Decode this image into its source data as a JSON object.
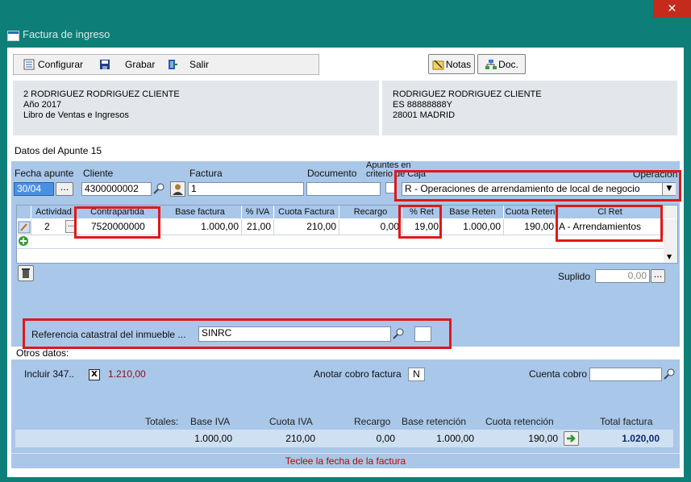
{
  "window": {
    "title": "Factura de ingreso",
    "close": "✕"
  },
  "toolbar": {
    "configurar": "Configurar",
    "grabar": "Grabar",
    "salir": "Salir",
    "notas": "Notas",
    "doc": "Doc."
  },
  "client_box": {
    "line1": "2 RODRIGUEZ RODRIGUEZ CLIENTE",
    "line2": "Año 2017",
    "line3": "Libro de Ventas e Ingresos"
  },
  "customer_box": {
    "line1": "RODRIGUEZ RODRIGUEZ CLIENTE",
    "line2": "ES 88888888Y",
    "line3": "28001 MADRID"
  },
  "apunte": {
    "title": "Datos del Apunte 15"
  },
  "form": {
    "fecha_label": "Fecha apunte",
    "fecha_value": "30/04",
    "cliente_label": "Cliente",
    "cliente_value": "4300000002",
    "factura_label": "Factura",
    "factura_value": "1",
    "documento_label": "Documento",
    "documento_value": "",
    "apuntes_label": "Apuntes en criterio de Caja",
    "operacion_label": "Operación",
    "operacion_value": "R - Operaciones de arrendamiento de local de negocio",
    "dots": "..."
  },
  "grid": {
    "headers": [
      "Actividad",
      "Contrapartida",
      "Base factura",
      "% IVA",
      "Cuota Factura",
      "Recargo",
      "% Ret",
      "Base Reten",
      "Cuota Reten",
      "Cl Ret"
    ],
    "row": [
      "2",
      "7520000000",
      "1.000,00",
      "21,00",
      "210,00",
      "0,00",
      "19,00",
      "1.000,00",
      "190,00",
      "A - Arrendamientos"
    ]
  },
  "suplido": {
    "label": "Suplido",
    "value": "0,00"
  },
  "catastral": {
    "label": "Referencia catastral del inmueble ...",
    "value": "SINRC"
  },
  "otros": {
    "title": "Otros datos:",
    "incluir_label": "Incluir 347..",
    "incluir_check": "X",
    "incluir_value": "1.210,00",
    "anotar_label": "Anotar cobro factura",
    "anotar_value": "N",
    "cuenta_label": "Cuenta cobro",
    "cuenta_value": ""
  },
  "totales": {
    "label": "Totales:",
    "headers": [
      "Base IVA",
      "Cuota IVA",
      "Recargo",
      "Base retención",
      "Cuota retención",
      "Total factura"
    ],
    "values": [
      "1.000,00",
      "210,00",
      "0,00",
      "1.000,00",
      "190,00",
      "1.020,00"
    ]
  },
  "status": "Teclee la fecha de la factura",
  "colors": {
    "frame": "#0e7f78",
    "panel": "#a9c7e9",
    "highlight": "#e01818",
    "status_text": "#c00000"
  }
}
